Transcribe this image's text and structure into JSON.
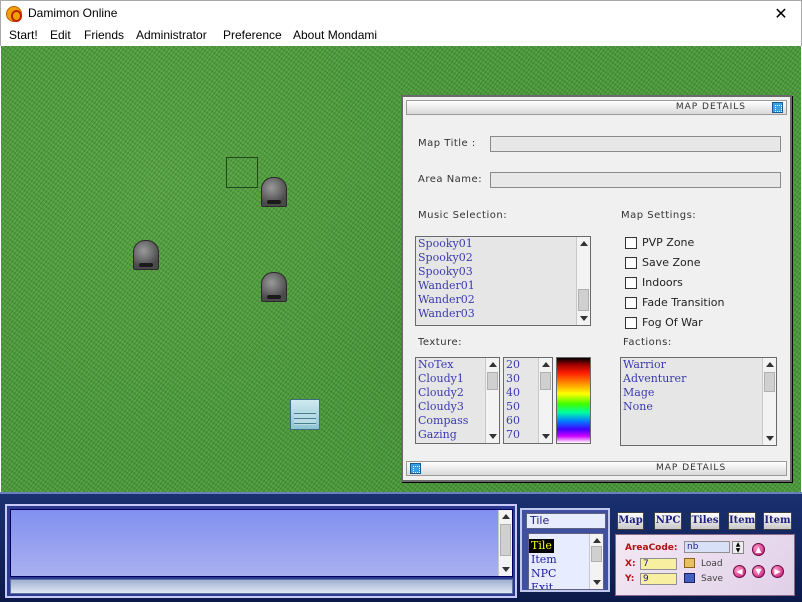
{
  "window": {
    "title": "Damimon Online",
    "close_glyph": "✕"
  },
  "menu": {
    "items": [
      "Start!",
      "Edit",
      "Friends",
      "Administrator",
      "Preference",
      "About Mondami"
    ]
  },
  "map_details": {
    "header": "MAP DETAILS",
    "footer": "MAP DETAILS",
    "map_title_label": "Map Title  :",
    "map_title_value": "",
    "area_name_label": "Area Name:",
    "area_name_value": "",
    "music_label": "Music Selection:",
    "music_items": [
      "Spooky01",
      "Spooky02",
      "Spooky03",
      "Wander01",
      "Wander02",
      "Wander03"
    ],
    "settings_label": "Map Settings:",
    "settings": [
      "PVP Zone",
      "Save Zone",
      "Indoors",
      "Fade Transition",
      "Fog Of War"
    ],
    "texture_label": "Texture:",
    "texture_items": [
      "NoTex",
      "Cloudy1",
      "Cloudy2",
      "Cloudy3",
      "Compass",
      "Gazing"
    ],
    "texture_sizes": [
      "20",
      "30",
      "40",
      "50",
      "60",
      "70"
    ],
    "factions_label": "Factions:",
    "factions": [
      "Warrior",
      "Adventurer",
      "Mage",
      "None"
    ]
  },
  "editor": {
    "mode_label": "Tile",
    "modes": [
      "Tile",
      "Item",
      "NPC",
      "Exit"
    ],
    "selected_mode": "Tile",
    "tabs": [
      "Map",
      "NPC",
      "Tiles",
      "Item",
      "Item"
    ]
  },
  "nav": {
    "areacode_label": "AreaCode:",
    "areacode_value": "nb",
    "x_label": "X:",
    "x_value": "7",
    "y_label": "Y:",
    "y_value": "9",
    "load_label": "Load",
    "save_label": "Save"
  },
  "icons": {
    "app": "damimon-logo-icon",
    "close": "close-icon",
    "panel_close": "panel-close-icon",
    "arrow_up": "arrow-up-icon",
    "arrow_left": "arrow-left-icon",
    "arrow_down": "arrow-down-icon",
    "arrow_right": "arrow-right-icon",
    "load": "folder-icon",
    "save": "disk-icon"
  },
  "colors": {
    "grass": "#4a9a3a",
    "panel_bg": "#f0f0f0",
    "list_text": "#3a3ab0",
    "bottom_bar": "#1a3070",
    "nav_label": "#b01010"
  }
}
